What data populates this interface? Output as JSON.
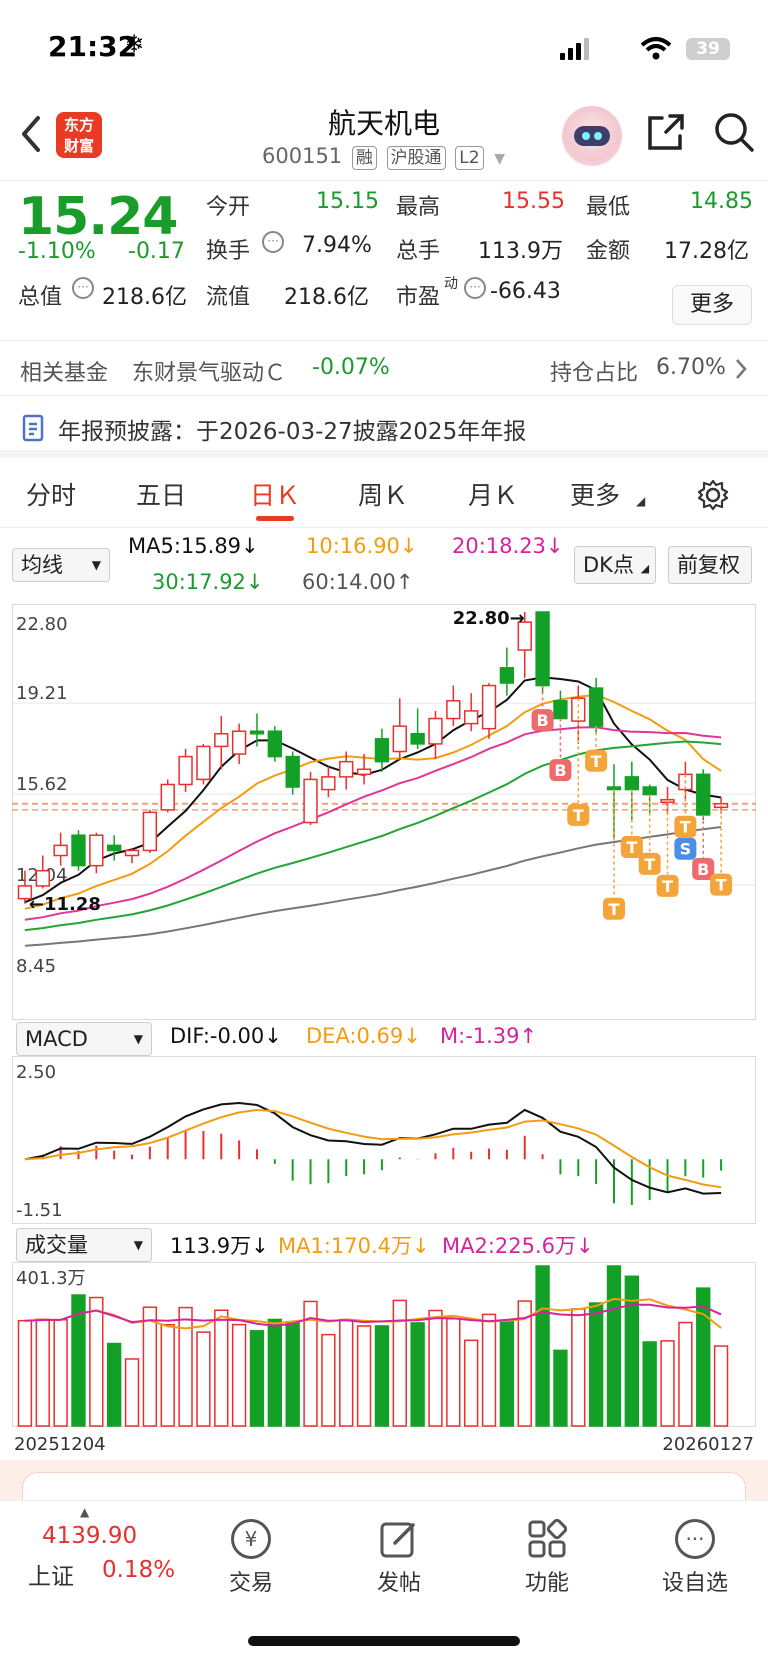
{
  "status": {
    "time": "21:32",
    "battery": "39"
  },
  "header": {
    "logo_line1": "东方",
    "logo_line2": "财富",
    "title": "航天机电",
    "code": "600151",
    "tags": [
      "融",
      "沪股通",
      "L2"
    ]
  },
  "quote": {
    "price": "15.24",
    "change_pct": "-1.10%",
    "change": "-0.17",
    "open_label": "今开",
    "open": "15.15",
    "high_label": "最高",
    "high": "15.55",
    "low_label": "最低",
    "low": "14.85",
    "turnover_label": "换手",
    "turnover": "7.94%",
    "volume_label": "总手",
    "volume": "113.9万",
    "amount_label": "金额",
    "amount": "17.28亿",
    "mktcap_label": "总值",
    "mktcap": "218.6亿",
    "float_label": "流值",
    "float_cap": "218.6亿",
    "pe_label": "市盈",
    "pe_sup": "动",
    "pe": "-66.43",
    "more_label": "更多"
  },
  "fund": {
    "label": "相关基金",
    "name": "东财景气驱动Ｃ",
    "change": "-0.07%",
    "holding_label": "持仓占比",
    "holding": "6.70%"
  },
  "notice": {
    "text": "年报预披露：于2026-03-27披露2025年年报"
  },
  "tabs": [
    "分时",
    "五日",
    "日Ｋ",
    "周Ｋ",
    "月Ｋ",
    "更多"
  ],
  "indicators": {
    "ma_select": "均线",
    "ma5": "MA5:15.89↓",
    "ma10": "10:16.90↓",
    "ma20": "20:18.23↓",
    "ma30": "30:17.92↓",
    "ma60": "60:14.00↑",
    "dk_label": "DK点",
    "fq_label": "前复权",
    "macd_select": "MACD",
    "dif": "DIF:-0.00↓",
    "dea": "DEA:0.69↓",
    "m": "M:-1.39↑",
    "vol_select": "成交量",
    "vol": "113.9万↓",
    "vol_ma1": "MA1:170.4万↓",
    "vol_ma2": "MA2:225.6万↓"
  },
  "chart_data": [
    {
      "type": "candlestick",
      "y_axis_labels": [
        "22.80",
        "19.21",
        "15.62",
        "12.04",
        "8.45"
      ],
      "ylim": [
        8.45,
        22.8
      ],
      "high_mark": "22.80",
      "low_mark": "11.28",
      "x_start": "20251204",
      "x_end": "20260127",
      "ohlc": [
        [
          11.5,
          12.6,
          11.3,
          12.0
        ],
        [
          12.0,
          13.2,
          11.9,
          12.6
        ],
        [
          13.2,
          14.1,
          12.8,
          13.6
        ],
        [
          14.0,
          14.2,
          12.6,
          12.8
        ],
        [
          12.8,
          14.1,
          12.5,
          14.0
        ],
        [
          13.6,
          14.0,
          13.0,
          13.4
        ],
        [
          13.2,
          13.5,
          12.9,
          13.4
        ],
        [
          13.4,
          15.0,
          13.3,
          14.9
        ],
        [
          15.0,
          16.2,
          14.9,
          16.0
        ],
        [
          16.0,
          17.4,
          15.7,
          17.1
        ],
        [
          16.2,
          17.6,
          16.0,
          17.5
        ],
        [
          17.5,
          18.7,
          16.6,
          18.0
        ],
        [
          17.2,
          18.4,
          16.8,
          18.1
        ],
        [
          18.1,
          18.8,
          17.5,
          18.0
        ],
        [
          18.1,
          18.3,
          16.9,
          17.1
        ],
        [
          17.1,
          17.3,
          15.6,
          15.9
        ],
        [
          14.5,
          16.5,
          14.4,
          16.2
        ],
        [
          15.8,
          16.7,
          15.5,
          16.3
        ],
        [
          16.3,
          17.3,
          15.8,
          16.9
        ],
        [
          16.4,
          17.2,
          16.0,
          16.6
        ],
        [
          17.8,
          18.2,
          16.5,
          16.9
        ],
        [
          17.3,
          19.4,
          17.0,
          18.3
        ],
        [
          18.0,
          19.0,
          17.4,
          17.6
        ],
        [
          17.6,
          18.9,
          17.0,
          18.6
        ],
        [
          18.6,
          19.9,
          18.3,
          19.3
        ],
        [
          18.4,
          19.6,
          18.1,
          18.9
        ],
        [
          18.2,
          20.0,
          17.8,
          19.9
        ],
        [
          20.6,
          21.4,
          19.5,
          20.0
        ],
        [
          21.3,
          22.8,
          20.2,
          22.4
        ],
        [
          22.8,
          22.8,
          19.6,
          19.9
        ],
        [
          19.3,
          19.7,
          18.5,
          18.6
        ],
        [
          18.5,
          19.9,
          17.6,
          19.4
        ],
        [
          19.8,
          20.2,
          18.0,
          18.3
        ],
        [
          15.9,
          16.8,
          13.9,
          15.8
        ],
        [
          16.3,
          16.9,
          14.6,
          15.8
        ],
        [
          15.9,
          16.0,
          14.8,
          15.6
        ],
        [
          15.3,
          15.9,
          14.8,
          15.4
        ],
        [
          15.8,
          16.9,
          15.4,
          16.4
        ],
        [
          16.4,
          16.6,
          14.6,
          14.8
        ],
        [
          15.1,
          15.5,
          14.85,
          15.24
        ]
      ],
      "series": [
        {
          "name": "MA5",
          "color": "#111111"
        },
        {
          "name": "MA10",
          "color": "#f39c12"
        },
        {
          "name": "MA20",
          "color": "#e0369a"
        },
        {
          "name": "MA30",
          "color": "#22a534"
        },
        {
          "name": "MA60",
          "color": "#777777"
        }
      ],
      "signals": [
        {
          "label": "B",
          "index": 29
        },
        {
          "label": "B",
          "index": 30
        },
        {
          "label": "T",
          "index": 31
        },
        {
          "label": "T",
          "index": 32
        },
        {
          "label": "S",
          "index": 37
        },
        {
          "label": "T",
          "index": 33
        },
        {
          "label": "T",
          "index": 34
        },
        {
          "label": "T",
          "index": 35
        },
        {
          "label": "T",
          "index": 36
        },
        {
          "label": "T",
          "index": 37
        },
        {
          "label": "B",
          "index": 38
        },
        {
          "label": "T",
          "index": 39
        }
      ]
    },
    {
      "type": "bar",
      "name": "MACD",
      "y_axis_labels": [
        "2.50",
        "-1.51"
      ],
      "ylim": [
        -1.51,
        2.5
      ]
    },
    {
      "type": "bar",
      "name": "成交量",
      "y_axis_labels": [
        "401.3万"
      ],
      "ylim": [
        0,
        401.3
      ]
    }
  ],
  "footer": {
    "index_value": "4139.90",
    "index_name": "上证",
    "index_change": "0.18%",
    "items": [
      "交易",
      "发帖",
      "功能",
      "设自选"
    ]
  }
}
